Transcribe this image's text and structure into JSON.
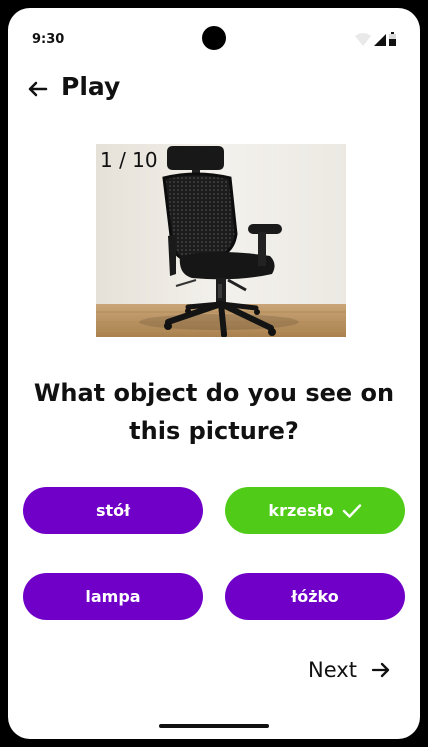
{
  "status_bar": {
    "time": "9:30"
  },
  "header": {
    "title": "Play",
    "back_icon": "arrow-left-icon"
  },
  "quiz": {
    "counter": "1 / 10",
    "question": "What object do you see on this picture?",
    "answers": [
      {
        "label": "stół",
        "state": "default"
      },
      {
        "label": "krzesło",
        "state": "correct"
      },
      {
        "label": "lampa",
        "state": "default"
      },
      {
        "label": "łóżko",
        "state": "default"
      }
    ]
  },
  "footer": {
    "next_label": "Next",
    "next_icon": "arrow-right-icon"
  },
  "colors": {
    "answer_default": "#7000c8",
    "answer_correct": "#50cc18"
  }
}
